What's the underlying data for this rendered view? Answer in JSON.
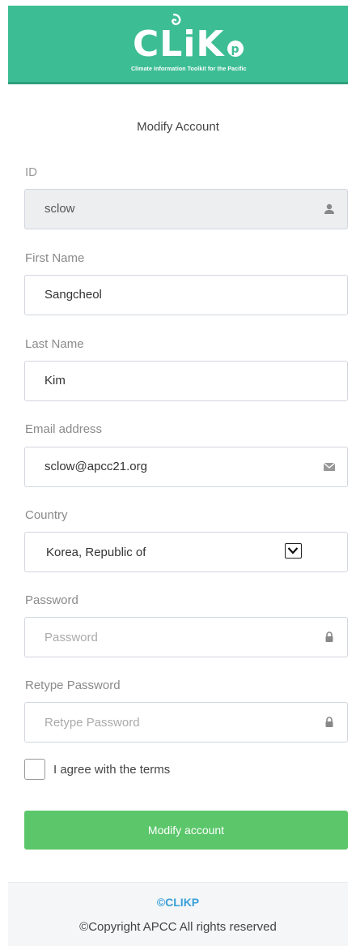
{
  "header": {
    "logo_text": "CLiKp",
    "logo_subtitle": "Climate Information Toolkit for the Pacific",
    "header_color": "#3dbd94"
  },
  "form": {
    "title": "Modify Account",
    "id": {
      "label": "ID",
      "value": "sclow",
      "icon": "user-icon"
    },
    "first_name": {
      "label": "First Name",
      "value": "Sangcheol"
    },
    "last_name": {
      "label": "Last Name",
      "value": "Kim"
    },
    "email": {
      "label": "Email address",
      "value": "sclow@apcc21.org",
      "icon": "envelope-icon"
    },
    "country": {
      "label": "Country",
      "selected": "Korea, Republic of",
      "icon": "chevron-down-icon"
    },
    "password": {
      "label": "Password",
      "placeholder": "Password",
      "icon": "lock-icon"
    },
    "retype_password": {
      "label": "Retype Password",
      "placeholder": "Retype Password",
      "icon": "lock-icon"
    },
    "terms": {
      "label": "I agree with the terms",
      "checked": false
    },
    "submit_label": "Modify account",
    "submit_color": "#5bc66a"
  },
  "footer": {
    "brand": "©CLIKP",
    "copyright": "©Copyright APCC All rights reserved",
    "brand_color": "#3a9fd8"
  }
}
